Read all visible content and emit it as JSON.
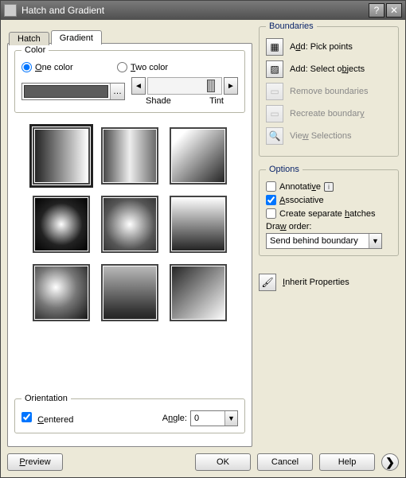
{
  "title": "Hatch and Gradient",
  "tabs": {
    "hatch": "Hatch",
    "gradient": "Gradient",
    "active": "gradient"
  },
  "color_group": {
    "legend": "Color",
    "one_color": "One color",
    "two_color": "Two color",
    "shade": "Shade",
    "tint": "Tint"
  },
  "orientation": {
    "legend": "Orientation",
    "centered": "Centered",
    "angle_label": "Angle:",
    "angle_value": "0"
  },
  "boundaries": {
    "legend": "Boundaries",
    "pick": "Add: Pick points",
    "select": "Add: Select objects",
    "remove": "Remove boundaries",
    "recreate": "Recreate boundary",
    "view": "View Selections"
  },
  "options": {
    "legend": "Options",
    "annotative": "Annotative",
    "associative": "Associative",
    "separate": "Create separate hatches",
    "draworder_label": "Draw order:",
    "draworder_value": "Send behind boundary"
  },
  "inherit": "Inherit Properties",
  "buttons": {
    "preview": "Preview",
    "ok": "OK",
    "cancel": "Cancel",
    "help": "Help"
  }
}
